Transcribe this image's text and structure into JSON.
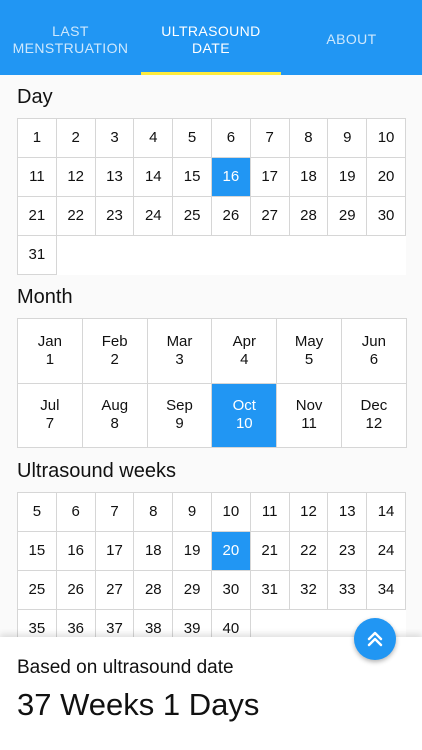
{
  "tabs": [
    {
      "label": "LAST\nMENSTRUATION",
      "active": false
    },
    {
      "label": "ULTRASOUND\nDATE",
      "active": true
    },
    {
      "label": "ABOUT",
      "active": false
    }
  ],
  "colors": {
    "accent": "#2196f3",
    "indicator": "#ffeb3b"
  },
  "day_section": {
    "title": "Day",
    "items": [
      "1",
      "2",
      "3",
      "4",
      "5",
      "6",
      "7",
      "8",
      "9",
      "10",
      "11",
      "12",
      "13",
      "14",
      "15",
      "16",
      "17",
      "18",
      "19",
      "20",
      "21",
      "22",
      "23",
      "24",
      "25",
      "26",
      "27",
      "28",
      "29",
      "30",
      "31"
    ],
    "selected": "16"
  },
  "month_section": {
    "title": "Month",
    "items": [
      {
        "name": "Jan",
        "num": "1"
      },
      {
        "name": "Feb",
        "num": "2"
      },
      {
        "name": "Mar",
        "num": "3"
      },
      {
        "name": "Apr",
        "num": "4"
      },
      {
        "name": "May",
        "num": "5"
      },
      {
        "name": "Jun",
        "num": "6"
      },
      {
        "name": "Jul",
        "num": "7"
      },
      {
        "name": "Aug",
        "num": "8"
      },
      {
        "name": "Sep",
        "num": "9"
      },
      {
        "name": "Oct",
        "num": "10"
      },
      {
        "name": "Nov",
        "num": "11"
      },
      {
        "name": "Dec",
        "num": "12"
      }
    ],
    "selected": "10"
  },
  "weeks_section": {
    "title": "Ultrasound weeks",
    "items": [
      "5",
      "6",
      "7",
      "8",
      "9",
      "10",
      "11",
      "12",
      "13",
      "14",
      "15",
      "16",
      "17",
      "18",
      "19",
      "20",
      "21",
      "22",
      "23",
      "24",
      "25",
      "26",
      "27",
      "28",
      "29",
      "30",
      "31",
      "32",
      "33",
      "34",
      "35",
      "36",
      "37",
      "38",
      "39",
      "40"
    ],
    "selected": "20"
  },
  "result": {
    "label": "Based on ultrasound date",
    "value": "37 Weeks 1 Days"
  },
  "fab": {
    "icon": "double-chevron-up-icon"
  }
}
